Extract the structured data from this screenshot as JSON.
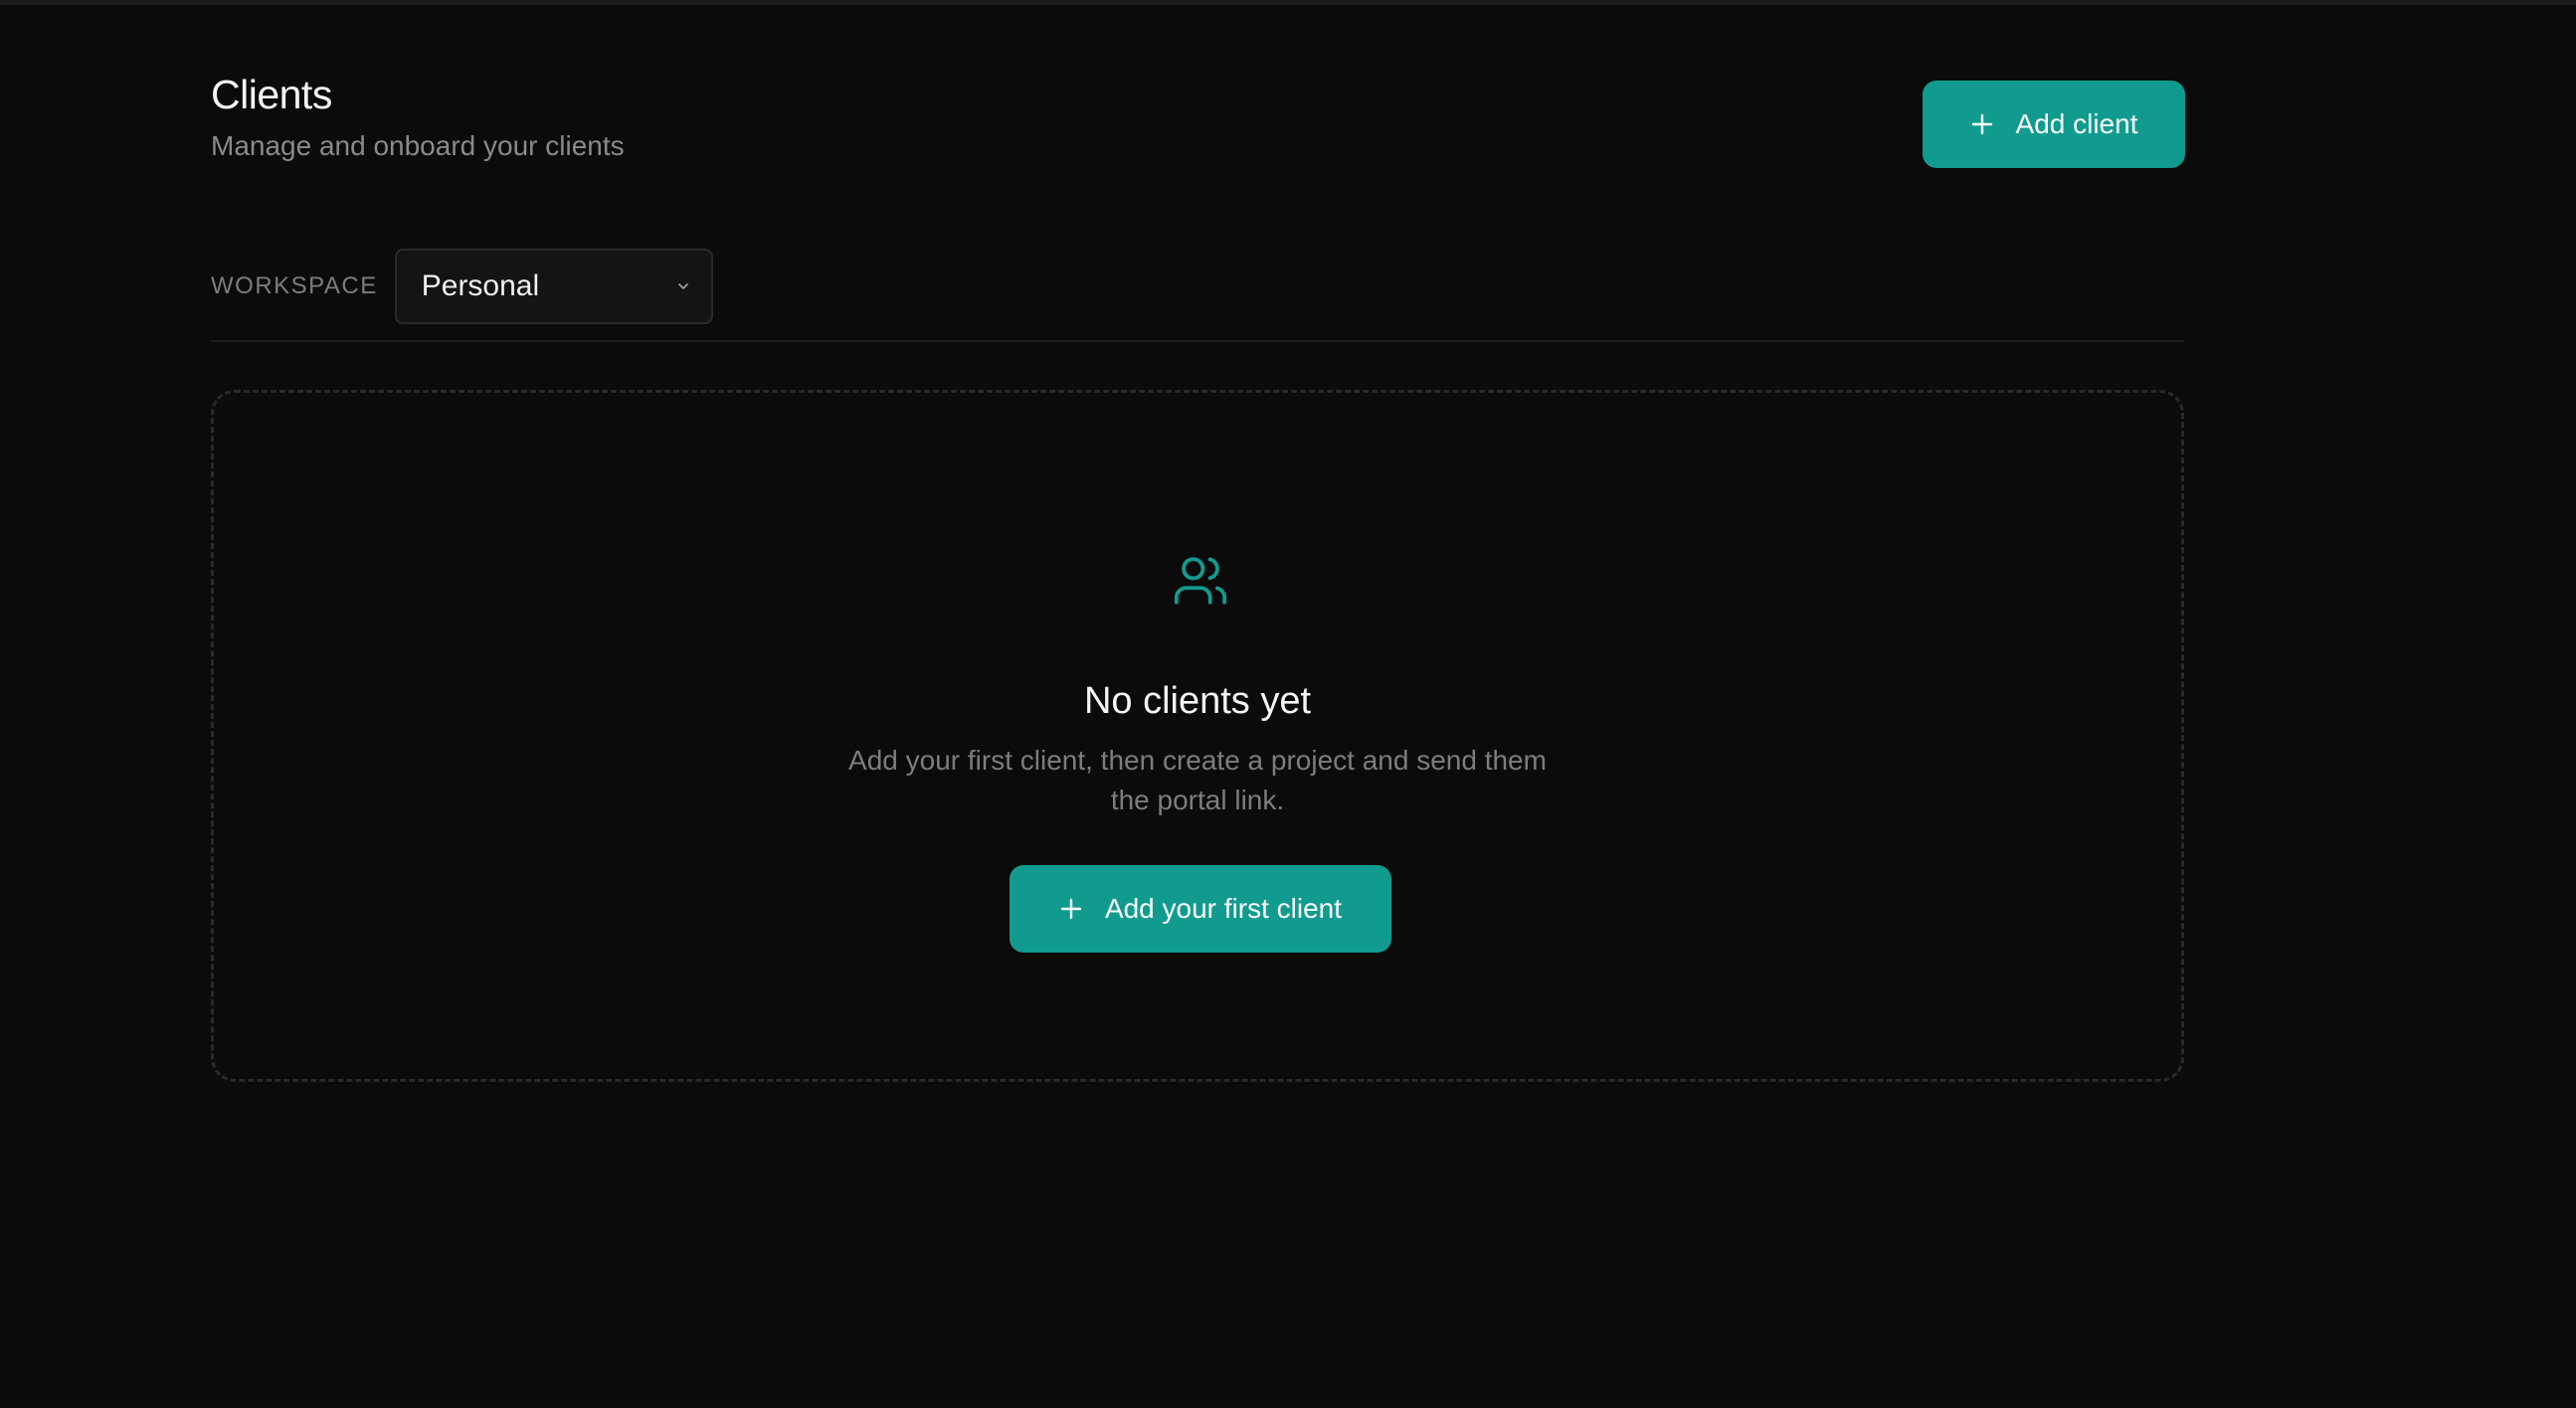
{
  "header": {
    "title": "Clients",
    "subtitle": "Manage and onboard your clients",
    "add_button_label": "Add client"
  },
  "workspace": {
    "label": "WORKSPACE",
    "selected": "Personal"
  },
  "empty_state": {
    "title": "No clients yet",
    "description_line1": "Add your first client, then create a project and send them",
    "description_line2": "the portal link.",
    "button_label": "Add your first client"
  },
  "icons": {
    "header_button": "plus-icon",
    "select": "chevron-down-icon",
    "empty_state": "users-icon",
    "empty_button": "plus-icon"
  },
  "colors": {
    "background": "#0b0b0b",
    "accent": "#119b8f",
    "muted_text": "#7d7d7d"
  }
}
